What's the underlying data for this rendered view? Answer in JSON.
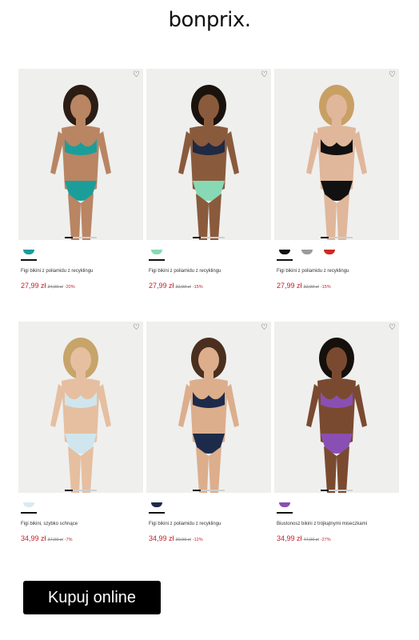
{
  "brand": {
    "logo_text": "bonprix."
  },
  "products": [
    {
      "name": "Figi bikini z poliamidu z recyklingu",
      "price": "27,99 zł",
      "old_price": "34,99 zł",
      "discount": "-20%",
      "swatches": [
        "#1a9c9c"
      ],
      "skin": "#b98563",
      "hair": "#2b1d14",
      "top": "#1b9e9a",
      "bottom": "#1b9e9a"
    },
    {
      "name": "Figi bikini z poliamidu z recyklingu",
      "price": "27,99 zł",
      "old_price": "32,99 zł",
      "discount": "-15%",
      "swatches": [
        "#86d9b4"
      ],
      "skin": "#8a5a3c",
      "hair": "#1a120d",
      "top": "#1f2a44",
      "bottom": "#86d9b4"
    },
    {
      "name": "Figi bikini z poliamidu z recyklingu",
      "price": "27,99 zł",
      "old_price": "32,99 zł",
      "discount": "-15%",
      "swatches": [
        "#111111",
        "#9b9b9b",
        "#cc2a22"
      ],
      "skin": "#e0b79a",
      "hair": "#c9a063",
      "top": "#111111",
      "bottom": "#111111"
    },
    {
      "name": "Figi bikini, szybko schnące",
      "price": "34,99 zł",
      "old_price": "37,99 zł",
      "discount": "-7%",
      "swatches": [
        "#d9eaf2"
      ],
      "skin": "#e5bfa0",
      "hair": "#c7a46a",
      "top": "#cfe6ef",
      "bottom": "#cfe6ef"
    },
    {
      "name": "Figi bikini z poliamidu z recyklingu",
      "price": "34,99 zł",
      "old_price": "39,99 zł",
      "discount": "-12%",
      "swatches": [
        "#1d2b4a"
      ],
      "skin": "#dcae8c",
      "hair": "#4a2f1f",
      "top": "#1d2b4a",
      "bottom": "#1d2b4a"
    },
    {
      "name": "Biustonosz bikini z trójkątnymi miseczkami",
      "price": "34,99 zł",
      "old_price": "47,99 zł",
      "discount": "-27%",
      "swatches": [
        "#8a4fb3"
      ],
      "skin": "#7a4a30",
      "hair": "#15100c",
      "top": "#8a4fb3",
      "bottom": "#8a4fb3"
    }
  ],
  "cta": {
    "label": "Kupuj online"
  }
}
